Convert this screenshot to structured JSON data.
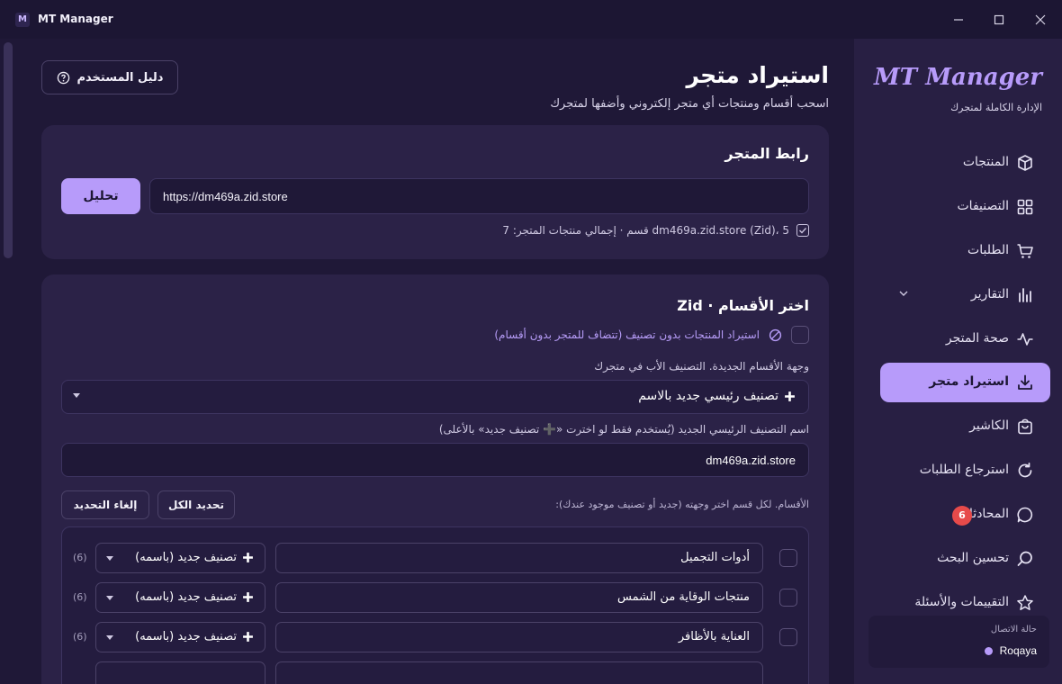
{
  "window": {
    "app_logo": "M",
    "title": "MT Manager"
  },
  "header": {
    "guide_label": "دليل المستخدم",
    "title": "استيراد متجر",
    "subtitle": "اسحب أقسام ومنتجات أي متجر إلكتروني وأضفها لمتجرك"
  },
  "store_link": {
    "title": "رابط المتجر",
    "analyze_label": "تحليل",
    "url_value": "https://dm469a.zid.store",
    "info": "dm469a.zid.store (Zid)، 5 قسم · إجمالي منتجات المتجر: 7"
  },
  "categories": {
    "title": "اختر الأقسام · Zid",
    "no_category_label": "استيراد المنتجات بدون تصنيف (تتضاف للمتجر بدون أقسام)",
    "destination_label": "وجهة الأقسام الجديدة. التصنيف الأب في متجرك",
    "destination_value": "تصنيف رئيسي جديد بالاسم",
    "new_name_label": "اسم التصنيف الرئيسي الجديد (يُستخدم فقط لو اخترت «➕ تصنيف جديد» بالأعلى)",
    "new_name_value": "dm469a.zid.store",
    "sections_hint": "الأقسام. لكل قسم اختر وجهته (جديد أو تصنيف موجود عندك):",
    "select_all_label": "تحديد الكل",
    "deselect_label": "إلغاء التحديد",
    "rows": [
      {
        "name": "أدوات التجميل",
        "target": "تصنيف جديد (باسمه)",
        "count": "(6)"
      },
      {
        "name": "منتجات الوقاية من الشمس",
        "target": "تصنيف جديد (باسمه)",
        "count": "(6)"
      },
      {
        "name": "العناية بالأظافر",
        "target": "تصنيف جديد (باسمه)",
        "count": "(6)"
      }
    ]
  },
  "sidebar": {
    "brand": "MT Manager",
    "brand_sub": "الإدارة الكاملة لمتجرك",
    "items": [
      {
        "label": "المنتجات"
      },
      {
        "label": "التصنيفات"
      },
      {
        "label": "الطلبات"
      },
      {
        "label": "التقارير"
      },
      {
        "label": "صحة المتجر"
      },
      {
        "label": "استيراد متجر"
      },
      {
        "label": "الكاشير"
      },
      {
        "label": "استرجاع الطلبات"
      },
      {
        "label": "المحادثات",
        "badge": "6"
      },
      {
        "label": "تحسين البحث"
      },
      {
        "label": "التقييمات والأسئلة"
      }
    ],
    "status_title": "حالة الاتصال",
    "status_user": "Roqaya"
  },
  "colors": {
    "accent": "#b79bfa",
    "background": "#1c1633",
    "card": "#2b2247",
    "sidebar": "#281f43",
    "badge": "#e74a4a"
  }
}
